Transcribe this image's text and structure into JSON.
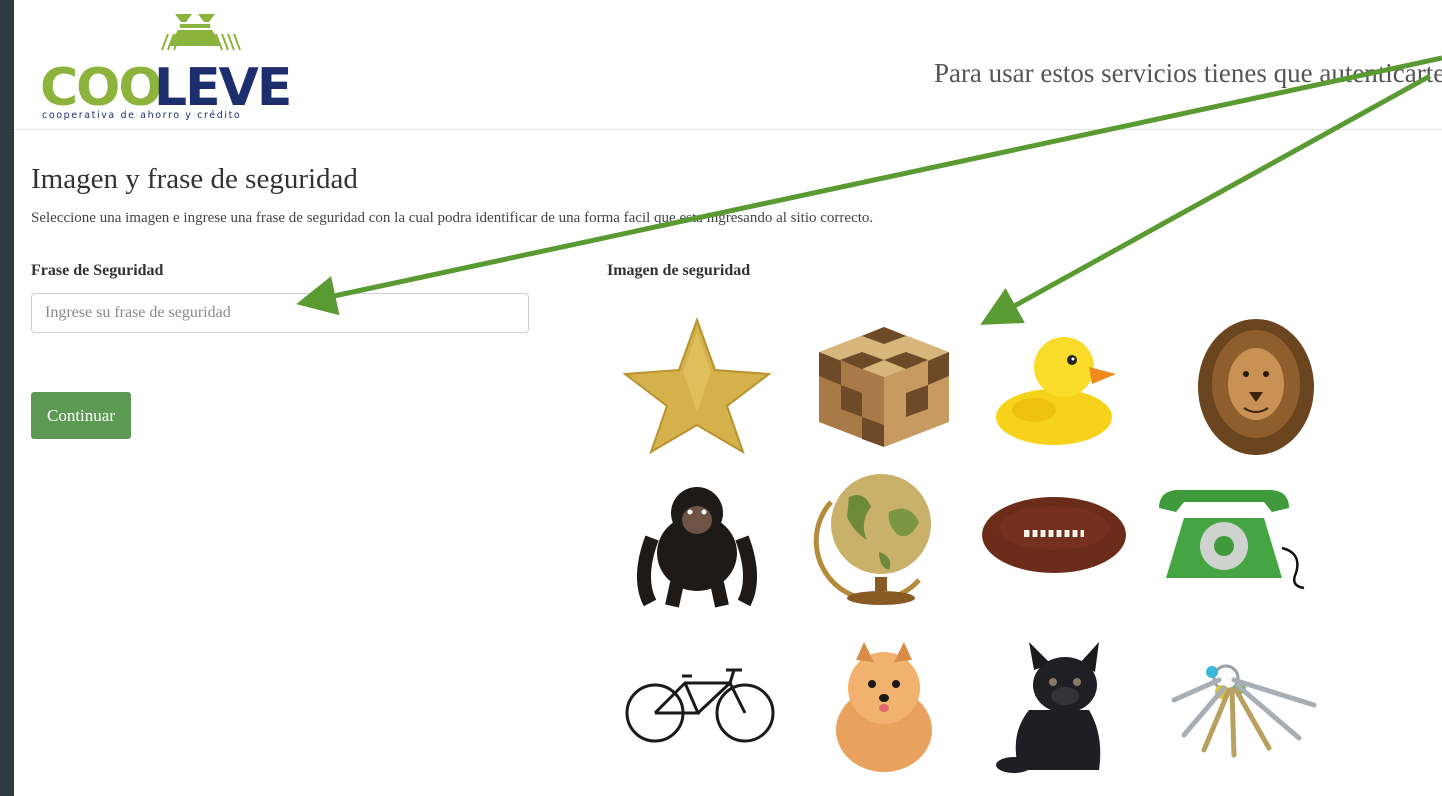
{
  "brand": {
    "logo_text": "COOLEVER",
    "logo_tagline": "cooperativa de ahorro y crédito",
    "colors": {
      "green": "#8cb43c",
      "navy": "#1d2e6e"
    }
  },
  "header": {
    "auth_message": "Para usar estos servicios tienes que autenticarte."
  },
  "main": {
    "title": "Imagen y frase de seguridad",
    "subtitle": "Seleccione una imagen e ingrese una frase de seguridad con la cual podra identificar de una forma facil que esta ingresando al sitio correcto.",
    "phrase_label": "Frase de Seguridad",
    "phrase_placeholder": "Ingrese su frase de seguridad",
    "phrase_value": "",
    "image_label": "Imagen de seguridad",
    "continue_label": "Continuar"
  },
  "security_images": [
    "star-icon",
    "cube-puzzle-icon",
    "rubber-duck-icon",
    "lion-icon",
    "chimpanzee-icon",
    "globe-icon",
    "football-icon",
    "telephone-icon",
    "bicycle-icon",
    "pomeranian-icon",
    "bulldog-icon",
    "keys-icon"
  ],
  "colors": {
    "button": "#5c9a54",
    "annotation_arrow": "#5a9a32"
  }
}
